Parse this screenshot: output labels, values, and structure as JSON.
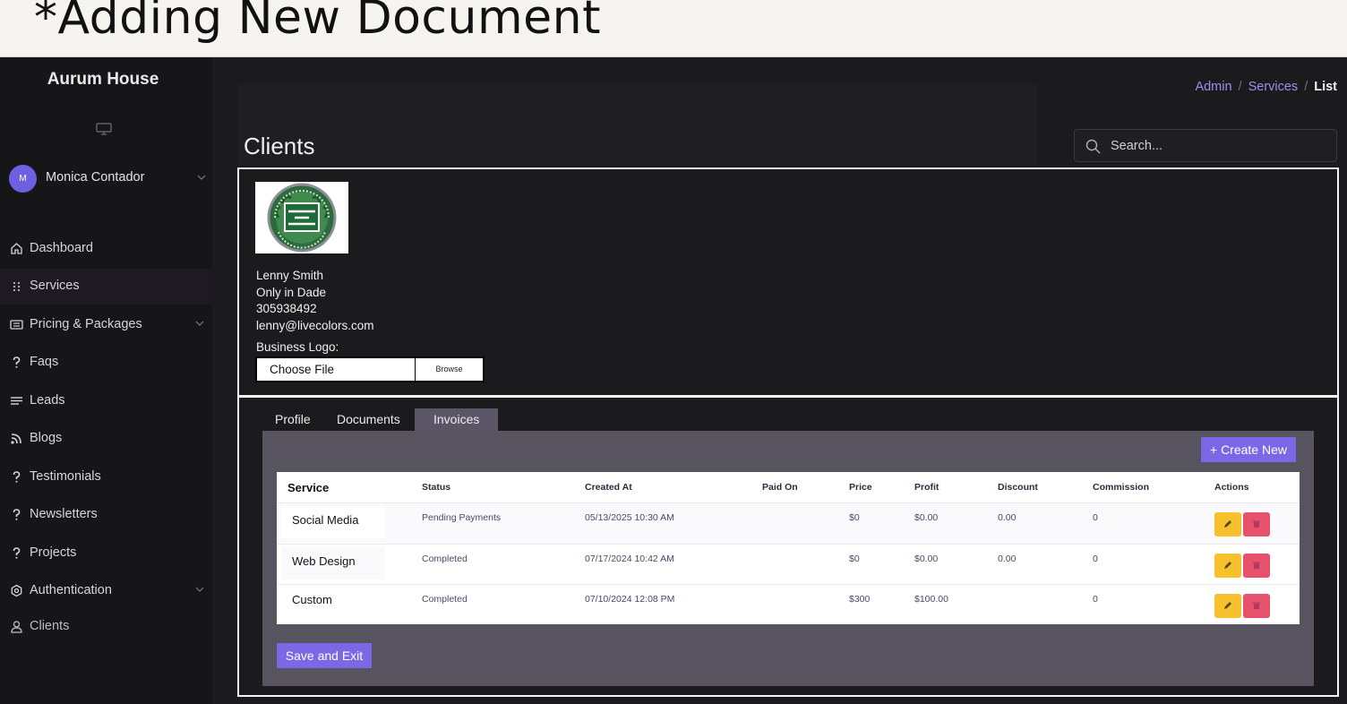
{
  "banner": {
    "title": "*Adding New Document"
  },
  "sidebar": {
    "brand": "Aurum House",
    "user": {
      "initial": "M",
      "name": "Monica Contador"
    },
    "items": [
      {
        "label": "Dashboard",
        "icon": "home-icon"
      },
      {
        "label": "Services",
        "icon": "grid-dots-icon",
        "active": true
      },
      {
        "label": "Pricing & Packages",
        "icon": "packages-icon",
        "has_submenu": true
      },
      {
        "label": "Faqs",
        "icon": "question-icon"
      },
      {
        "label": "Leads",
        "icon": "list-icon"
      },
      {
        "label": "Blogs",
        "icon": "blog-icon"
      },
      {
        "label": "Testimonials",
        "icon": "question-icon"
      },
      {
        "label": "Newsletters",
        "icon": "question-icon"
      },
      {
        "label": "Projects",
        "icon": "question-icon"
      },
      {
        "label": "Authentication",
        "icon": "gear-icon",
        "has_submenu": true
      },
      {
        "label": "Clients",
        "icon": "user-icon"
      }
    ]
  },
  "header": {
    "title": "Clients",
    "breadcrumb": {
      "first": "Admin",
      "second": "Services",
      "current": "List"
    },
    "search": {
      "placeholder": "Search..."
    }
  },
  "client": {
    "logo_alt": "Only in Dade logo",
    "name": "Lenny Smith",
    "company": "Only in Dade",
    "phone": "305938492",
    "email": "lenny@livecolors.com",
    "logo_label": "Business Logo:",
    "file": {
      "choose": "Choose File",
      "browse": "Browse"
    }
  },
  "tabs": [
    {
      "label": "Profile"
    },
    {
      "label": "Documents"
    },
    {
      "label": "Invoices",
      "active": true
    }
  ],
  "invoices": {
    "create_label": "+ Create New",
    "save_label": "Save and Exit",
    "columns": [
      "Service",
      "Status",
      "Created At",
      "Paid On",
      "Price",
      "Profit",
      "Discount",
      "Commission",
      "Actions"
    ],
    "rows": [
      {
        "service": "Social Media",
        "status": "Pending Payments",
        "created_at": "05/13/2025 10:30 AM",
        "paid_on": "",
        "price": "$0",
        "profit": "$0.00",
        "discount": "0.00",
        "commission": "0"
      },
      {
        "service": "Web Design",
        "status": "Completed",
        "created_at": "07/17/2024 10:42 AM",
        "paid_on": "",
        "price": "$0",
        "profit": "$0.00",
        "discount": "0.00",
        "commission": "0"
      },
      {
        "service": "Custom",
        "status": "Completed",
        "created_at": "07/10/2024 12:08 PM",
        "paid_on": "",
        "price": "$300",
        "profit": "$100.00",
        "discount": "",
        "commission": "0"
      }
    ]
  },
  "colors": {
    "accent": "#7a68e6",
    "edit": "#f7c12d",
    "delete": "#e7516c",
    "panel": "#57535f"
  }
}
